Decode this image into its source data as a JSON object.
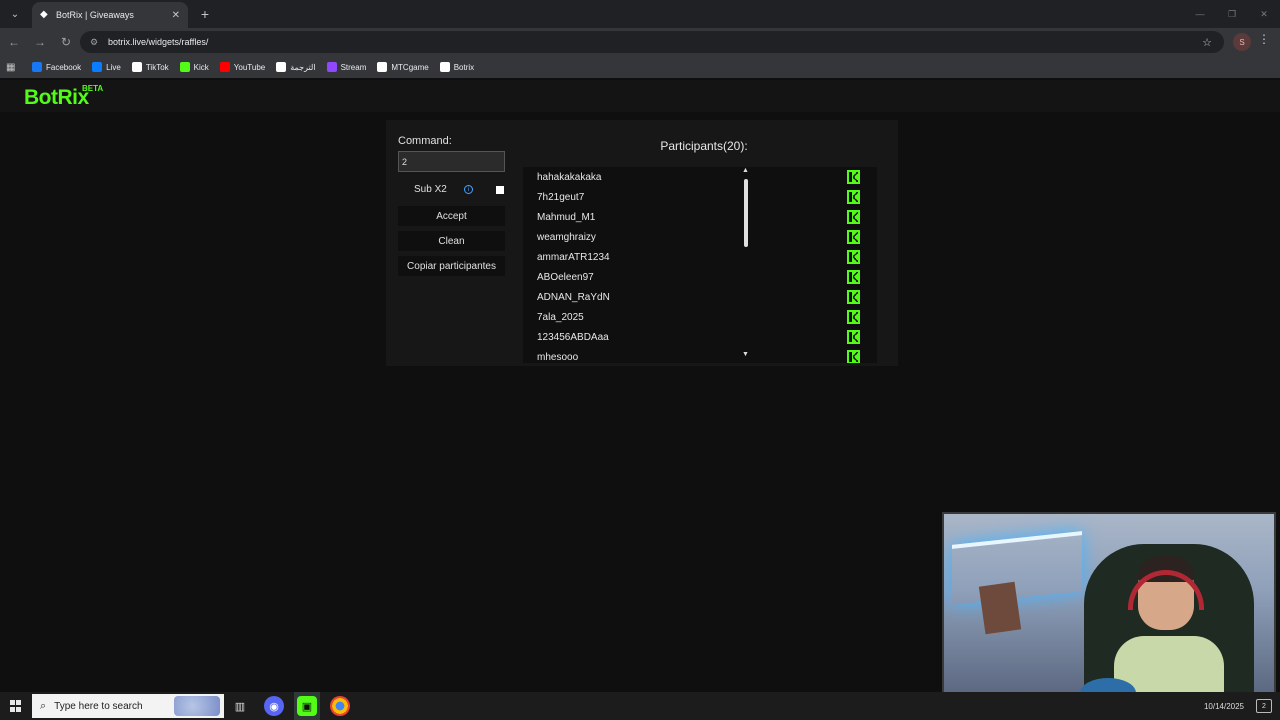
{
  "browser": {
    "tab_title": "BotRix | Giveaways",
    "url": "botrix.live/widgets/raffles/",
    "profile_initial": "S",
    "bookmarks": [
      {
        "label": "Facebook",
        "icon": "facebook-icon",
        "color": "#1877f2"
      },
      {
        "label": "Live",
        "icon": "meta-icon",
        "color": "#0a7cff"
      },
      {
        "label": "TikTok",
        "icon": "tiktok-icon",
        "color": "#ffffff"
      },
      {
        "label": "Kick",
        "icon": "kick-icon",
        "color": "#53fc18"
      },
      {
        "label": "YouTube",
        "icon": "youtube-icon",
        "color": "#ff0000"
      },
      {
        "label": "الترجمة",
        "icon": "google-icon",
        "color": "#ffffff"
      },
      {
        "label": "Stream",
        "icon": "stream-icon",
        "color": "#9146ff"
      },
      {
        "label": "MTCgame",
        "icon": "mtcgame-icon",
        "color": "#ffffff"
      },
      {
        "label": "Botrix",
        "icon": "botrix-icon",
        "color": "#ffffff"
      }
    ]
  },
  "site": {
    "logo": "BotRix",
    "logo_badge": "BETA",
    "accent": "#53fc18"
  },
  "raffle": {
    "command_label": "Command:",
    "command_value": "2",
    "sub_label": "Sub X2",
    "sub_checked": false,
    "accept_label": "Accept",
    "clean_label": "Clean",
    "copy_label": "Copiar participantes",
    "participants_title": "Participants(20):",
    "participants": [
      "hahakakakaka",
      "7h21geut7",
      "Mahmud_M1",
      "weamghraizy",
      "ammarATR1234",
      "ABOeleen97",
      "ADNAN_RaYdN",
      "7ala_2025",
      "123456ABDAaa",
      "mhesooo"
    ]
  },
  "taskbar": {
    "search_placeholder": "Type here to search",
    "date": "10/14/2025",
    "notifications": "2"
  }
}
